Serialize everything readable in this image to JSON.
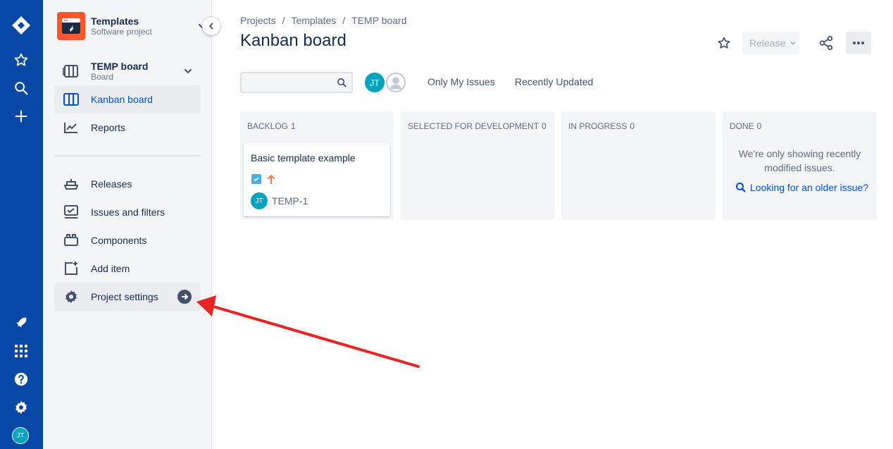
{
  "global_nav": {
    "avatar_initials": "JT"
  },
  "sidebar": {
    "project_name": "Templates",
    "project_type": "Software project",
    "board_name": "TEMP board",
    "board_type": "Board",
    "items": [
      {
        "label": "Kanban board",
        "icon": "board-icon",
        "active": true
      },
      {
        "label": "Reports",
        "icon": "chart-icon"
      },
      {
        "label": "Releases",
        "icon": "ship-icon"
      },
      {
        "label": "Issues and filters",
        "icon": "issues-icon"
      },
      {
        "label": "Components",
        "icon": "components-icon"
      },
      {
        "label": "Add item",
        "icon": "add-item-icon"
      },
      {
        "label": "Project settings",
        "icon": "gear-icon"
      }
    ]
  },
  "header": {
    "breadcrumbs": [
      "Projects",
      "Templates",
      "TEMP board"
    ],
    "title": "Kanban board",
    "release_label": "Release"
  },
  "filters": {
    "search_value": "",
    "avatar_initials": "JT",
    "quick_filters": [
      "Only My Issues",
      "Recently Updated"
    ]
  },
  "columns": [
    {
      "name": "BACKLOG",
      "count": "1"
    },
    {
      "name": "SELECTED FOR DEVELOPMENT",
      "count": "0"
    },
    {
      "name": "IN PROGRESS",
      "count": "0"
    },
    {
      "name": "DONE",
      "count": "0"
    }
  ],
  "card": {
    "title": "Basic template example",
    "assignee_initials": "JT",
    "key": "TEMP-1"
  },
  "done_column": {
    "message": "We're only showing recently modified issues.",
    "link": "Looking for an older issue?"
  },
  "colors": {
    "global_nav": "#0747a6",
    "sidebar": "#f4f5f7",
    "accent": "#0052cc",
    "project_avatar": "#ff5630",
    "user_avatar": "#00a3bf",
    "annotation_arrow": "#e92424"
  }
}
